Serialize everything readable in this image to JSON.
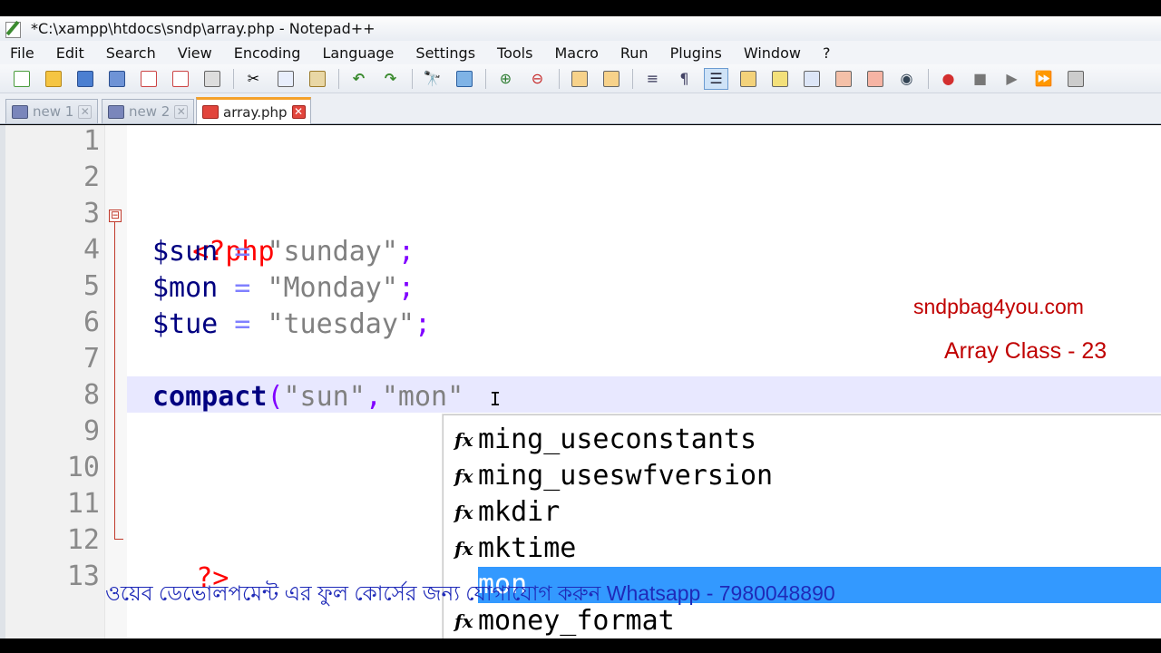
{
  "window": {
    "title": "*C:\\xampp\\htdocs\\sndp\\array.php - Notepad++"
  },
  "menu": [
    "File",
    "Edit",
    "Search",
    "View",
    "Encoding",
    "Language",
    "Settings",
    "Tools",
    "Macro",
    "Run",
    "Plugins",
    "Window",
    "?"
  ],
  "tabs": [
    {
      "label": "new 1",
      "active": false
    },
    {
      "label": "new 2",
      "active": false
    },
    {
      "label": "array.php",
      "active": true
    }
  ],
  "editor": {
    "line_numbers": [
      "1",
      "2",
      "3",
      "4",
      "5",
      "6",
      "7",
      "8",
      "9",
      "10",
      "11",
      "12",
      "13"
    ],
    "line3": {
      "open": "<?php"
    },
    "line4": {
      "var": "$sun",
      "op": " = ",
      "str": "\"sunday\"",
      "end": ";"
    },
    "line5": {
      "var": "$mon",
      "op": " = ",
      "str": "\"Monday\"",
      "end": ";"
    },
    "line6": {
      "var": "$tue",
      "op": " = ",
      "str": "\"tuesday\"",
      "end": ";"
    },
    "line8": {
      "fn": "compact",
      "paren": "(",
      "arg1": "\"sun\"",
      "comma": ",",
      "arg2": "\"mon\""
    },
    "line12": {
      "close": "?>"
    },
    "fold_marker": "⊟"
  },
  "autocomplete": {
    "items": [
      "ming_useconstants",
      "ming_useswfversion",
      "mkdir",
      "mktime",
      "mon",
      "money_format"
    ],
    "selected_index": 4,
    "icon_label": "fx"
  },
  "overlay": {
    "site": "sndpbag4you.com",
    "class_title": "Array Class - 23",
    "banner": "ওয়েব ডেভোলপমেন্ট এর ফুল কোর্সের জন্য যোগাযোগ করুন Whatsapp - 7980048890"
  },
  "colors": {
    "selection": "#3399ff",
    "current_line": "#e8e8ff",
    "overlay_red": "#c00000",
    "banner_blue": "#1f2ab8"
  }
}
